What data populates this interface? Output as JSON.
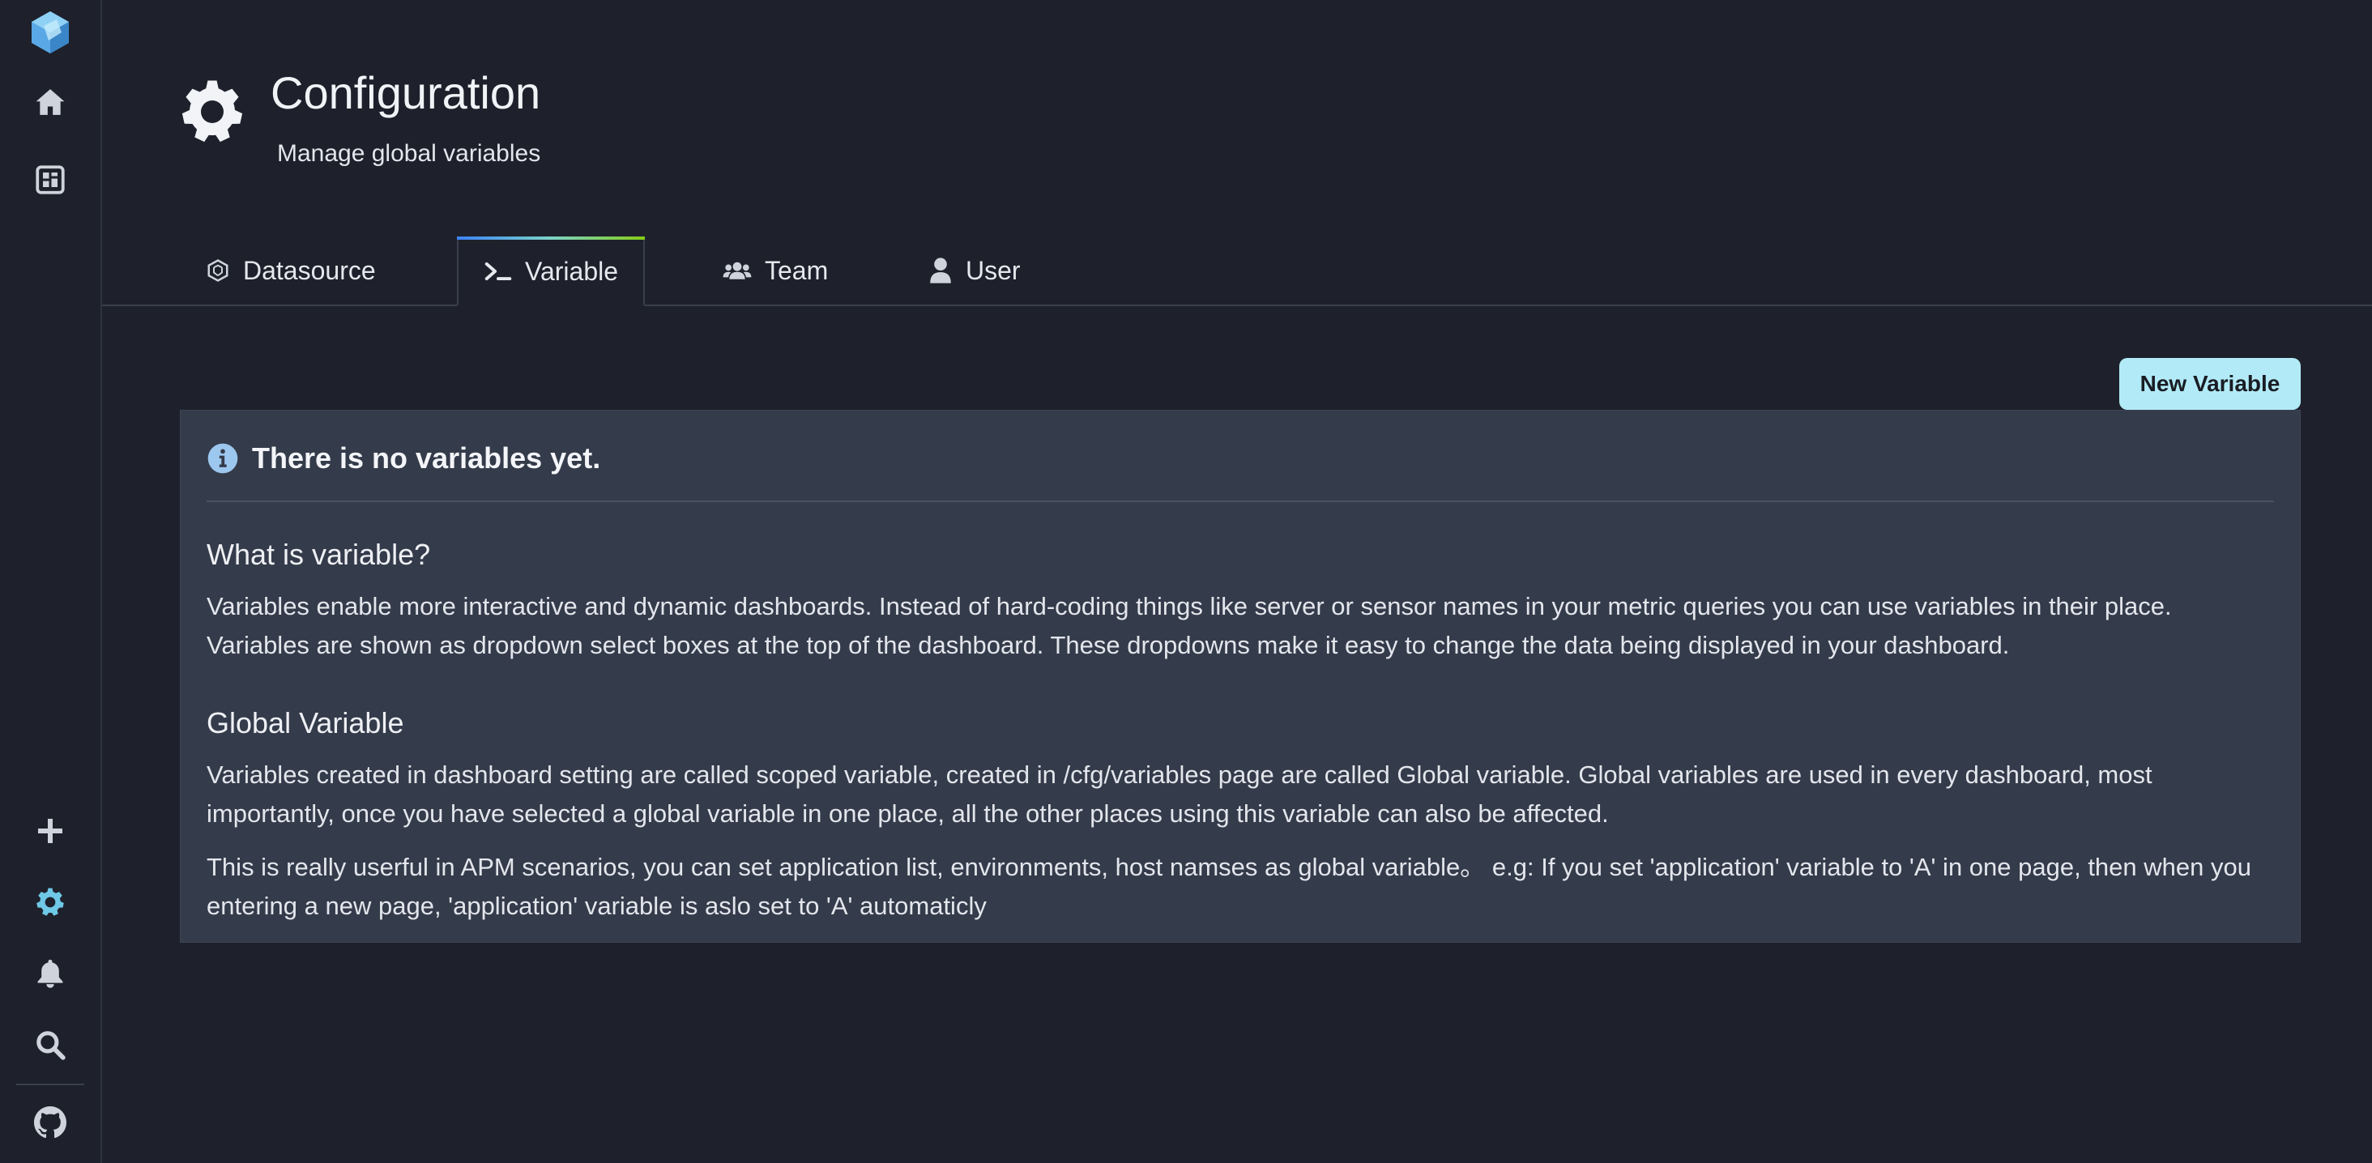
{
  "sidebar": {
    "items": [
      {
        "name": "logo",
        "icon": "logo-icon"
      },
      {
        "name": "home",
        "icon": "home-icon"
      },
      {
        "name": "dashboards",
        "icon": "dashboard-icon"
      },
      {
        "name": "new",
        "icon": "plus-icon"
      },
      {
        "name": "configuration",
        "icon": "gear-icon",
        "active": true
      },
      {
        "name": "alerting",
        "icon": "bell-icon"
      },
      {
        "name": "search",
        "icon": "search-icon"
      },
      {
        "name": "github",
        "icon": "github-icon"
      }
    ],
    "active_color": "#6ec8e6"
  },
  "header": {
    "title": "Configuration",
    "subtitle": "Manage global variables",
    "icon": "gear-icon"
  },
  "tabs": [
    {
      "label": "Datasource",
      "icon": "datasource-icon",
      "active": false
    },
    {
      "label": "Variable",
      "icon": "terminal-icon",
      "active": true
    },
    {
      "label": "Team",
      "icon": "team-icon",
      "active": false
    },
    {
      "label": "User",
      "icon": "user-icon",
      "active": false
    }
  ],
  "toolbar": {
    "new_variable_label": "New Variable"
  },
  "empty_state": {
    "title": "There is no variables yet.",
    "icon": "info-icon",
    "sections": [
      {
        "heading": "What is variable?",
        "paragraphs": [
          "Variables enable more interactive and dynamic dashboards. Instead of hard-coding things like server or sensor names in your metric queries you can use variables in their place. Variables are shown as dropdown select boxes at the top of the dashboard. These dropdowns make it easy to change the data being displayed in your dashboard."
        ]
      },
      {
        "heading": "Global Variable",
        "paragraphs": [
          "Variables created in dashboard setting are called scoped variable, created in /cfg/variables page are called Global variable. Global variables are used in every dashboard, most importantly, once you have selected a global variable in one place, all the other places using this variable can also be affected.",
          "This is really userful in APM scenarios, you can set application list, environments, host namses as global variable。 e.g: If you set 'application' variable to 'A' in one page, then when you entering a new page, 'application' variable is aslo set to 'A' automaticly"
        ]
      }
    ]
  },
  "colors": {
    "background": "#1e212b",
    "panel": "#343b4a",
    "accent": "#b2ebf7",
    "info": "#9cc7ef"
  }
}
